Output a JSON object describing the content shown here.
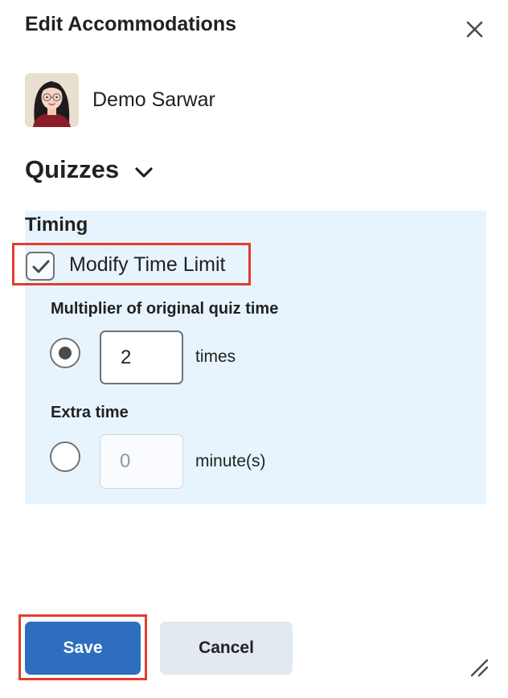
{
  "dialog": {
    "title": "Edit Accommodations",
    "close_icon": "close-icon"
  },
  "user": {
    "name": "Demo Sarwar",
    "avatar_icon": "user-avatar"
  },
  "section": {
    "title": "Quizzes",
    "toggle_icon": "chevron-down-icon"
  },
  "timing": {
    "heading": "Timing",
    "modify_time_limit": {
      "label": "Modify Time Limit",
      "checked": true
    },
    "multiplier": {
      "label": "Multiplier of original quiz time",
      "selected": true,
      "value": "2",
      "unit": "times"
    },
    "extra_time": {
      "label": "Extra time",
      "selected": false,
      "value": "0",
      "unit": "minute(s)"
    }
  },
  "footer": {
    "save_label": "Save",
    "cancel_label": "Cancel",
    "resize_icon": "resize-handle-icon"
  },
  "colors": {
    "primary": "#2d6ebe",
    "panel_bg": "#e8f4fd",
    "highlight": "#e03e2d",
    "secondary_bg": "#e3e9f1"
  }
}
